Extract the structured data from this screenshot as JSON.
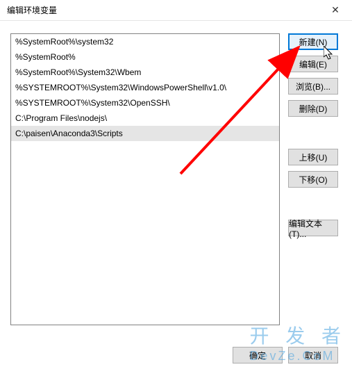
{
  "window": {
    "title": "编辑环境变量"
  },
  "path_entries": [
    "%SystemRoot%\\system32",
    "%SystemRoot%",
    "%SystemRoot%\\System32\\Wbem",
    "%SYSTEMROOT%\\System32\\WindowsPowerShell\\v1.0\\",
    "%SYSTEMROOT%\\System32\\OpenSSH\\",
    "C:\\Program Files\\nodejs\\",
    "C:\\paisen\\Anaconda3\\Scripts"
  ],
  "selected_index": 6,
  "buttons": {
    "new": "新建(N)",
    "edit": "编辑(E)",
    "browse": "浏览(B)...",
    "delete": "删除(D)",
    "move_up": "上移(U)",
    "move_down": "下移(O)",
    "edit_text": "编辑文本(T)...",
    "ok": "确定",
    "cancel": "取消"
  },
  "watermark": {
    "line1": "开 发 者",
    "line2": "DevZe.CoM"
  }
}
